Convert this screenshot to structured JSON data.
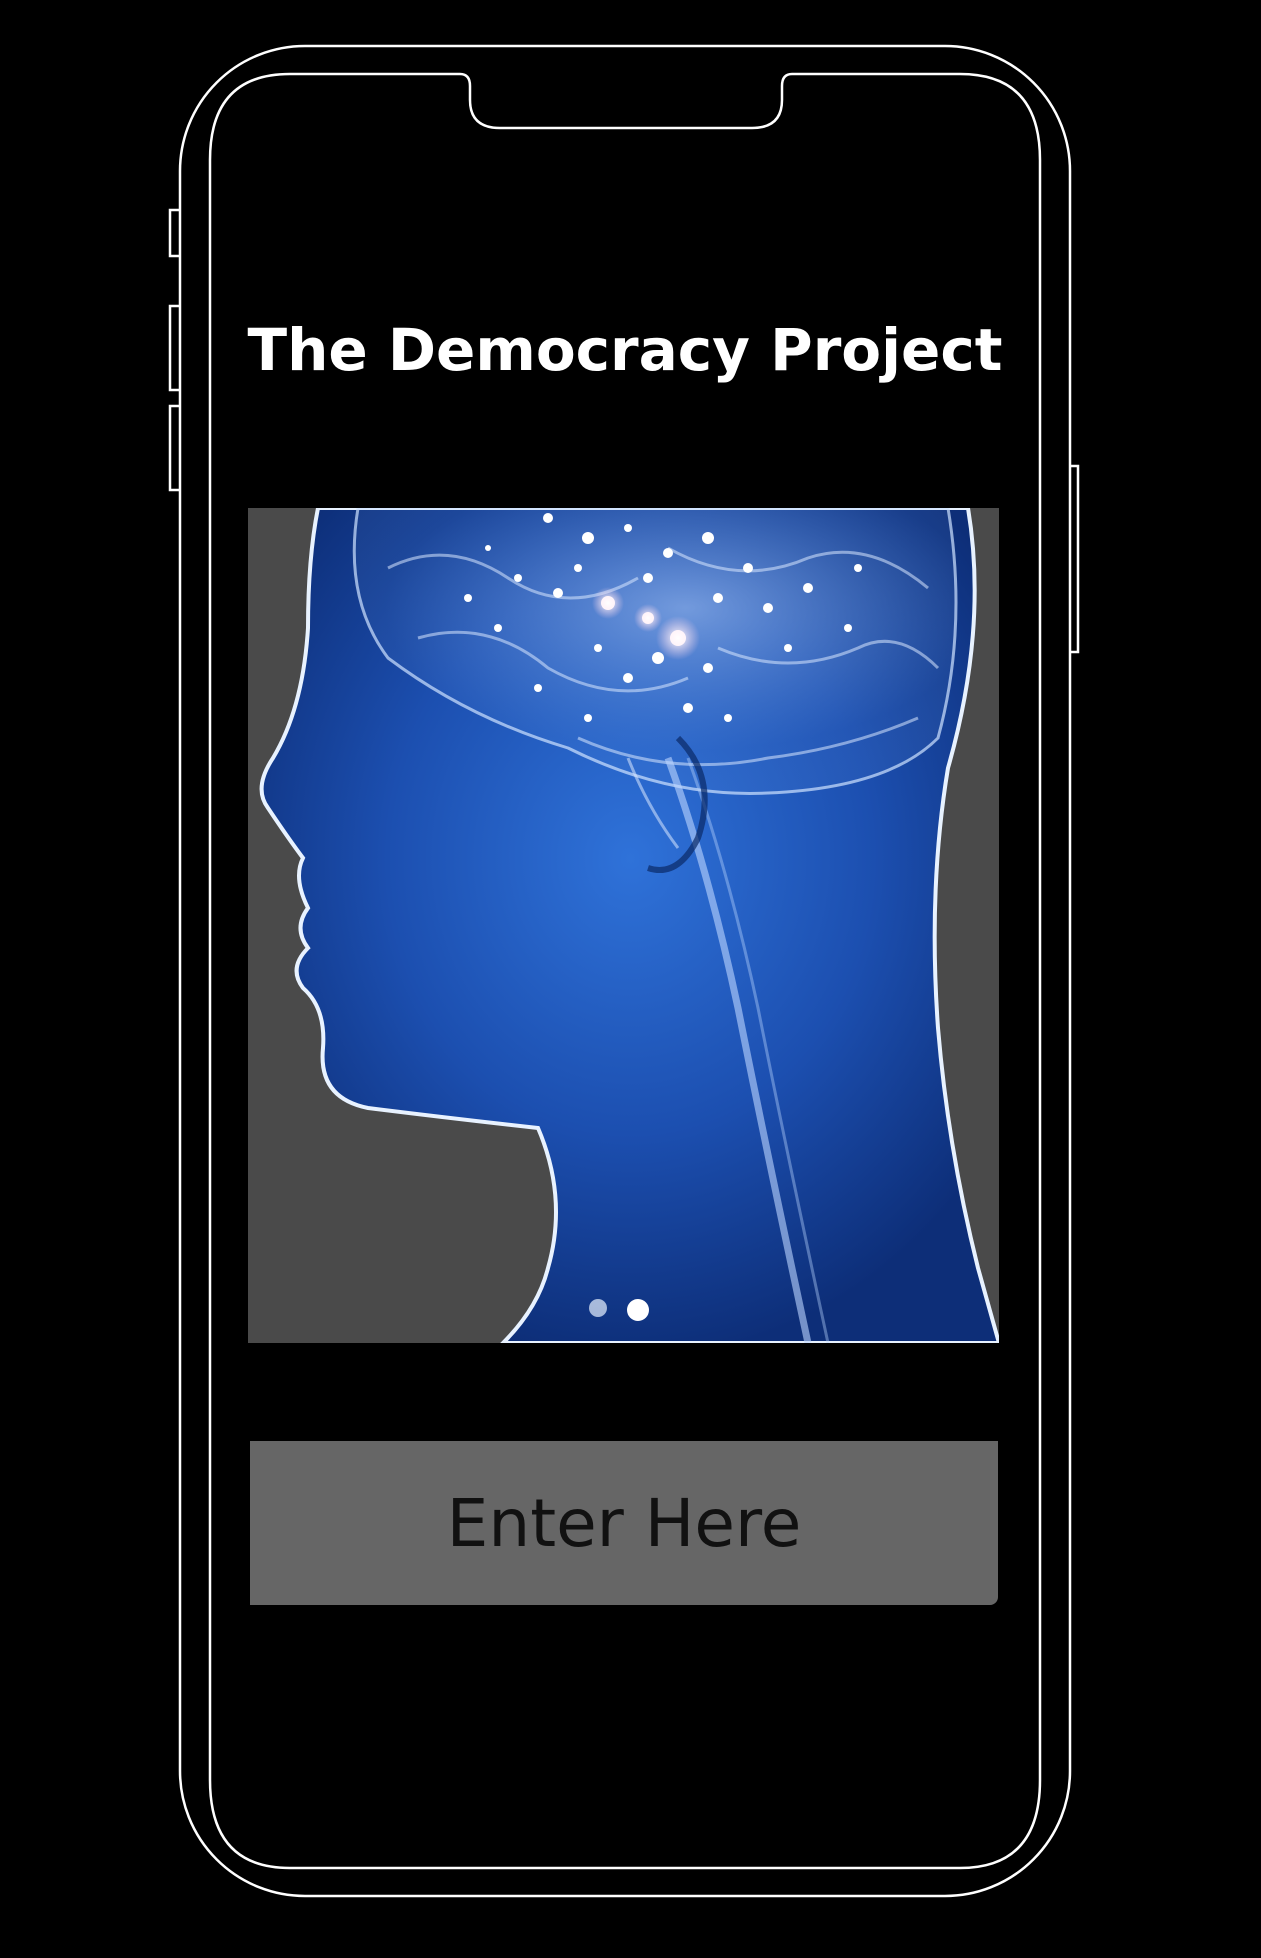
{
  "app": {
    "title": "The Democracy Project"
  },
  "hero": {
    "image_name": "human-head-brain-illustration"
  },
  "cta": {
    "label": "Enter Here"
  },
  "colors": {
    "background": "#000000",
    "frame_outline": "#ffffff",
    "button_bg": "#666666",
    "button_text": "#111111",
    "image_bg": "#4a4a4a",
    "head_blue": "#1f5bbf"
  }
}
